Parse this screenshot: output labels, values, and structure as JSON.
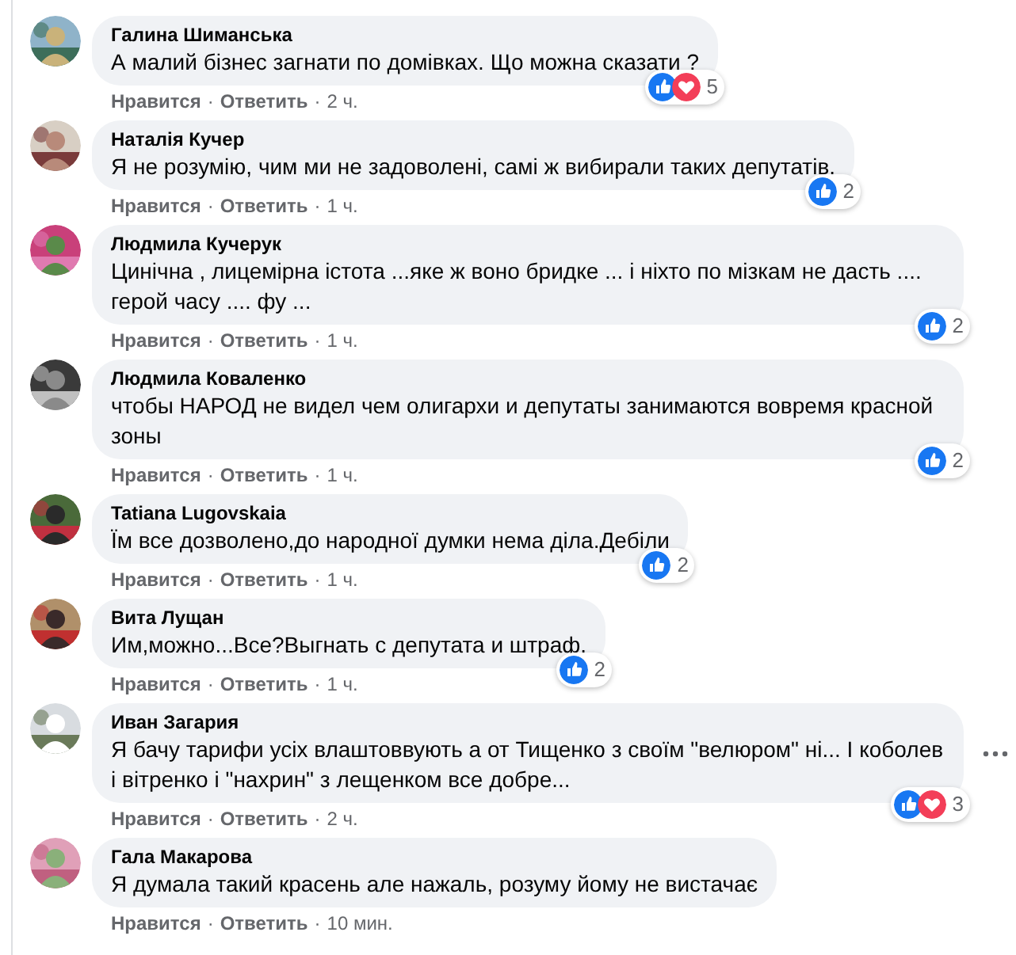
{
  "separator": "·",
  "comments": [
    {
      "author": "Галина Шиманська",
      "text": "А малий бізнес загнати по домівках. Що можна сказати ?",
      "like": true,
      "love": true,
      "reaction_count": "5",
      "actions": [
        "Нравится",
        "Ответить",
        "2 ч."
      ],
      "more_button": false
    },
    {
      "author": "Наталія Кучер",
      "text": "Я не розумію, чим ми не задоволені, самі ж вибирали таких депутатів.",
      "like": true,
      "love": false,
      "reaction_count": "2",
      "actions": [
        "Нравится",
        "Ответить",
        "1 ч."
      ],
      "more_button": false
    },
    {
      "author": "Людмила Кучерук",
      "text": "Цинічна , лицемірна істота ...яке ж воно бридке ... і ніхто по мізкам не дасть .... герой часу .... фу ...",
      "like": true,
      "love": false,
      "reaction_count": "2",
      "actions": [
        "Нравится",
        "Ответить",
        "1 ч."
      ],
      "more_button": false
    },
    {
      "author": "Людмила Коваленко",
      "text": "чтобы НАРОД не видел чем олигархи и депутаты занимаются вовремя красной зоны",
      "like": true,
      "love": false,
      "reaction_count": "2",
      "actions": [
        "Нравится",
        "Ответить",
        "1 ч."
      ],
      "more_button": false
    },
    {
      "author": "Tatiana Lugovskaia",
      "text": "Їм все дозволено,до народної думки нема діла.Дебіли",
      "like": true,
      "love": false,
      "reaction_count": "2",
      "actions": [
        "Нравится",
        "Ответить",
        "1 ч."
      ],
      "more_button": false
    },
    {
      "author": "Вита Лущан",
      "text": "Им,можно...Все?Выгнать с депутата и штраф.",
      "like": true,
      "love": false,
      "reaction_count": "2",
      "actions": [
        "Нравится",
        "Ответить",
        "1 ч."
      ],
      "more_button": false
    },
    {
      "author": "Иван Загария",
      "text": "Я бачу тарифи усіх влаштоввують а от Тищенко з своїм \"велюром\" ні... І коболев і вітренко і \"нахрин\" з лещенком все добре...",
      "like": true,
      "love": true,
      "reaction_count": "3",
      "actions": [
        "Нравится",
        "Ответить",
        "2 ч."
      ],
      "more_button": true
    },
    {
      "author": "Гала Макарова",
      "text": "Я думала такий красень але нажаль, розуму йому не вистачає",
      "actions": [
        "Нравится",
        "Ответить",
        "10 мин."
      ],
      "more_button": false
    }
  ]
}
